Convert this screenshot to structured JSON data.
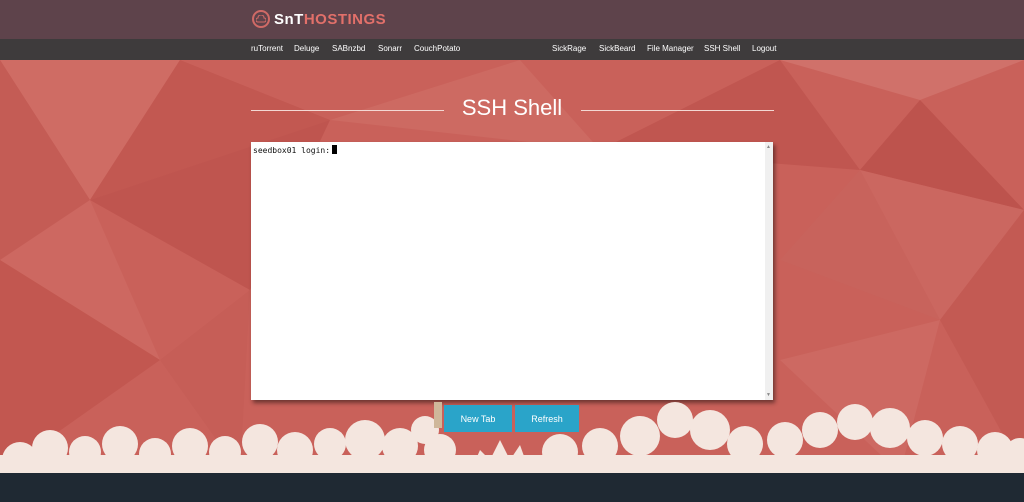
{
  "brand": {
    "part1": "SnT",
    "part2": "HOSTINGS"
  },
  "nav": {
    "items": [
      {
        "label": "ruTorrent"
      },
      {
        "label": "Deluge"
      },
      {
        "label": "SABnzbd"
      },
      {
        "label": "Sonarr"
      },
      {
        "label": "CouchPotato"
      },
      {
        "label": "SickRage"
      },
      {
        "label": "SickBeard"
      },
      {
        "label": "File Manager"
      },
      {
        "label": "SSH Shell"
      },
      {
        "label": "Logout"
      }
    ]
  },
  "page": {
    "title": "SSH Shell"
  },
  "terminal": {
    "prompt": "seedbox01 login:"
  },
  "actions": {
    "new_tab": "New Tab",
    "refresh": "Refresh"
  },
  "colors": {
    "topbar": "#5e434b",
    "nav": "#3e3b3c",
    "hero": "#c9615a",
    "button": "#2aa4c9",
    "footer": "#1f2933",
    "cloud": "#f4e6df"
  },
  "icons": {
    "logo": "cloud-icon",
    "scroll_up": "arrow-up-icon",
    "scroll_down": "arrow-down-icon"
  }
}
